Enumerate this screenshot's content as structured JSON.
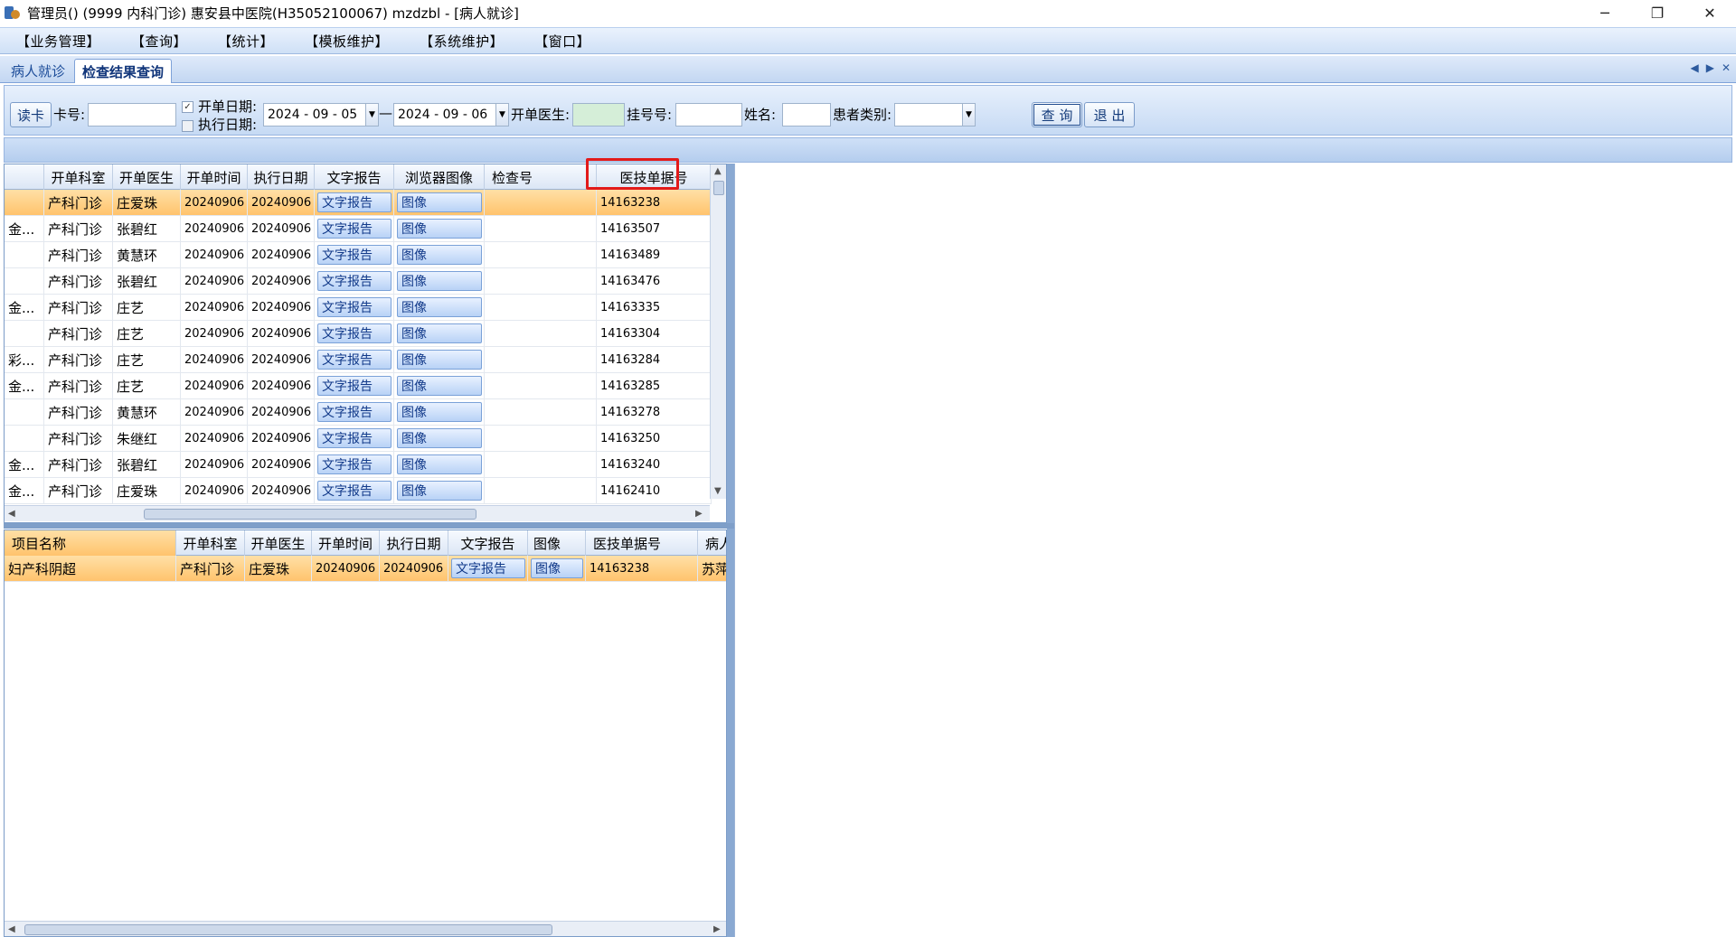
{
  "window": {
    "title": "管理员() (9999 内科门诊) 惠安县中医院(H35052100067) mzdzbl - [病人就诊]",
    "controls": {
      "minimize": "─",
      "restore": "❐",
      "close": "✕"
    }
  },
  "menu": [
    "【业务管理】",
    "【查询】",
    "【统计】",
    "【模板维护】",
    "【系统维护】",
    "【窗口】"
  ],
  "tabs": {
    "patient_visit": "病人就诊",
    "exam_query": "检查结果查询"
  },
  "toolbar": {
    "read_card": "读卡",
    "card_no_label": "卡号:",
    "card_no_value": "",
    "open_date_label": "开单日期:",
    "open_date_checked": true,
    "exec_date_label": "执行日期:",
    "exec_date_checked": false,
    "date_from": "2024 - 09 - 05",
    "date_sep": "—",
    "date_to": "2024 - 09 - 06",
    "doctor_label": "开单医生:",
    "doctor_value": "",
    "reg_no_label": "挂号号:",
    "reg_no_value": "",
    "name_label": "姓名:",
    "name_value": "",
    "patient_type_label": "患者类别:",
    "patient_type_value": "",
    "query_button": "查 询",
    "exit_button": "退 出"
  },
  "upper_grid": {
    "columns": [
      "开单科室",
      "开单医生",
      "开单时间",
      "执行日期",
      "文字报告",
      "浏览器图像",
      "检查号",
      "医技单据号"
    ],
    "rows": [
      {
        "prefix": "",
        "dept": "产科门诊",
        "doctor": "庄爱珠",
        "open_time": "20240906",
        "exec_date": "20240906",
        "report": "文字报告",
        "image": "图像",
        "exam_no": "",
        "bill_no": "14163238",
        "selected": true
      },
      {
        "prefix": "金...",
        "dept": "产科门诊",
        "doctor": "张碧红",
        "open_time": "20240906",
        "exec_date": "20240906",
        "report": "文字报告",
        "image": "图像",
        "exam_no": "",
        "bill_no": "14163507",
        "selected": false
      },
      {
        "prefix": "",
        "dept": "产科门诊",
        "doctor": "黄慧环",
        "open_time": "20240906",
        "exec_date": "20240906",
        "report": "文字报告",
        "image": "图像",
        "exam_no": "",
        "bill_no": "14163489",
        "selected": false
      },
      {
        "prefix": "",
        "dept": "产科门诊",
        "doctor": "张碧红",
        "open_time": "20240906",
        "exec_date": "20240906",
        "report": "文字报告",
        "image": "图像",
        "exam_no": "",
        "bill_no": "14163476",
        "selected": false
      },
      {
        "prefix": "金...",
        "dept": "产科门诊",
        "doctor": "庄艺",
        "open_time": "20240906",
        "exec_date": "20240906",
        "report": "文字报告",
        "image": "图像",
        "exam_no": "",
        "bill_no": "14163335",
        "selected": false
      },
      {
        "prefix": "",
        "dept": "产科门诊",
        "doctor": "庄艺",
        "open_time": "20240906",
        "exec_date": "20240906",
        "report": "文字报告",
        "image": "图像",
        "exam_no": "",
        "bill_no": "14163304",
        "selected": false
      },
      {
        "prefix": "彩...",
        "dept": "产科门诊",
        "doctor": "庄艺",
        "open_time": "20240906",
        "exec_date": "20240906",
        "report": "文字报告",
        "image": "图像",
        "exam_no": "",
        "bill_no": "14163284",
        "selected": false
      },
      {
        "prefix": "金...",
        "dept": "产科门诊",
        "doctor": "庄艺",
        "open_time": "20240906",
        "exec_date": "20240906",
        "report": "文字报告",
        "image": "图像",
        "exam_no": "",
        "bill_no": "14163285",
        "selected": false
      },
      {
        "prefix": "",
        "dept": "产科门诊",
        "doctor": "黄慧环",
        "open_time": "20240906",
        "exec_date": "20240906",
        "report": "文字报告",
        "image": "图像",
        "exam_no": "",
        "bill_no": "14163278",
        "selected": false
      },
      {
        "prefix": "",
        "dept": "产科门诊",
        "doctor": "朱继红",
        "open_time": "20240906",
        "exec_date": "20240906",
        "report": "文字报告",
        "image": "图像",
        "exam_no": "",
        "bill_no": "14163250",
        "selected": false
      },
      {
        "prefix": "金...",
        "dept": "产科门诊",
        "doctor": "张碧红",
        "open_time": "20240906",
        "exec_date": "20240906",
        "report": "文字报告",
        "image": "图像",
        "exam_no": "",
        "bill_no": "14163240",
        "selected": false
      },
      {
        "prefix": "金...",
        "dept": "产科门诊",
        "doctor": "庄爱珠",
        "open_time": "20240906",
        "exec_date": "20240906",
        "report": "文字报告",
        "image": "图像",
        "exam_no": "",
        "bill_no": "14162410",
        "selected": false
      }
    ]
  },
  "lower_grid": {
    "columns": [
      "项目名称",
      "开单科室",
      "开单医生",
      "开单时间",
      "执行日期",
      "文字报告",
      "图像",
      "医技单据号",
      "病人"
    ],
    "rows": [
      {
        "item": "妇产科阴超",
        "dept": "产科门诊",
        "doctor": "庄爱珠",
        "open_time": "20240906",
        "exec_date": "20240906",
        "report": "文字报告",
        "image": "图像",
        "bill_no": "14163238",
        "patient": "苏萍",
        "selected": true
      }
    ]
  },
  "colors": {
    "accent": "#c3d7f2",
    "selection": "#ffc36d",
    "highlight_box": "#e21a1a"
  }
}
